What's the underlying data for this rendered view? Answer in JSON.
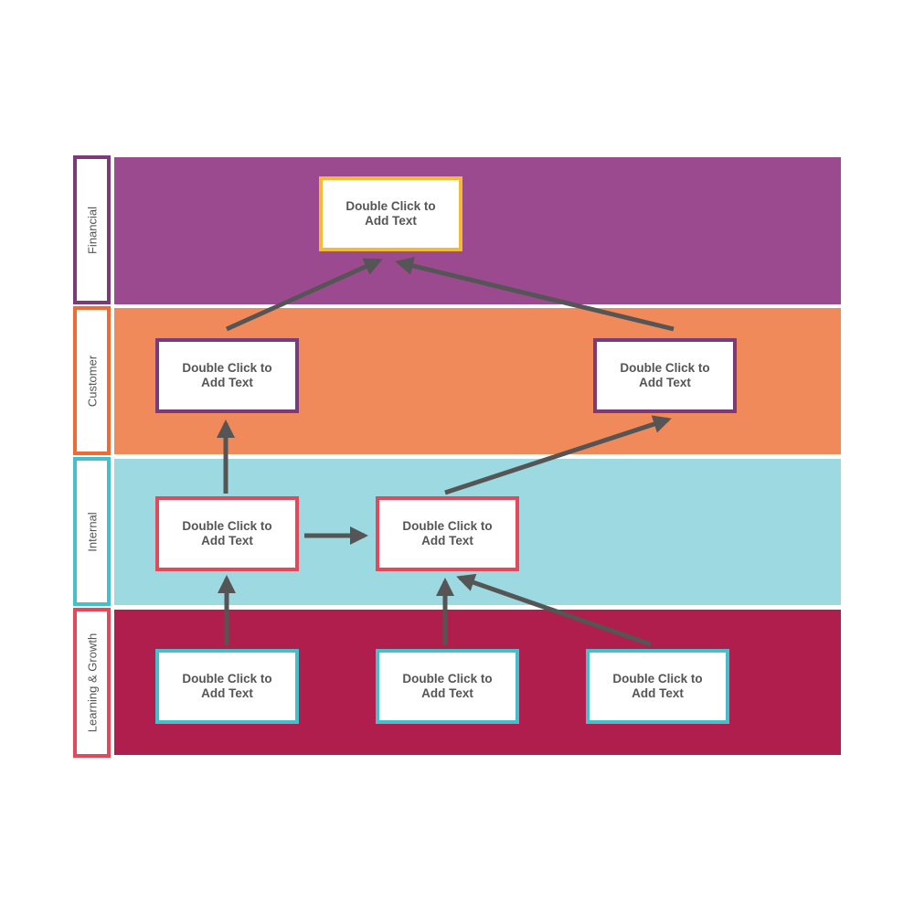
{
  "colors": {
    "financial": "#9b4a8f",
    "customer": "#f08a5a",
    "internal": "#9dd9e0",
    "learning": "#b01e4e",
    "arrow": "#555555",
    "yellow": "#f4b935",
    "purple": "#7b3a78",
    "red": "#e3495a",
    "teal": "#45bfc9",
    "orange": "#ee6b33"
  },
  "lanes": [
    {
      "label": "Financial"
    },
    {
      "label": "Customer"
    },
    {
      "label": "Internal"
    },
    {
      "label": "Learning & Growth"
    }
  ],
  "boxes": [
    {
      "text": "Double Click to\nAdd Text"
    },
    {
      "text": "Double Click to\nAdd Text"
    },
    {
      "text": "Double Click to\nAdd Text"
    },
    {
      "text": "Double Click to\nAdd Text"
    },
    {
      "text": "Double Click to\nAdd Text"
    },
    {
      "text": "Double Click to\nAdd Text"
    },
    {
      "text": "Double Click to\nAdd Text"
    },
    {
      "text": "Double Click to\nAdd Text"
    }
  ]
}
